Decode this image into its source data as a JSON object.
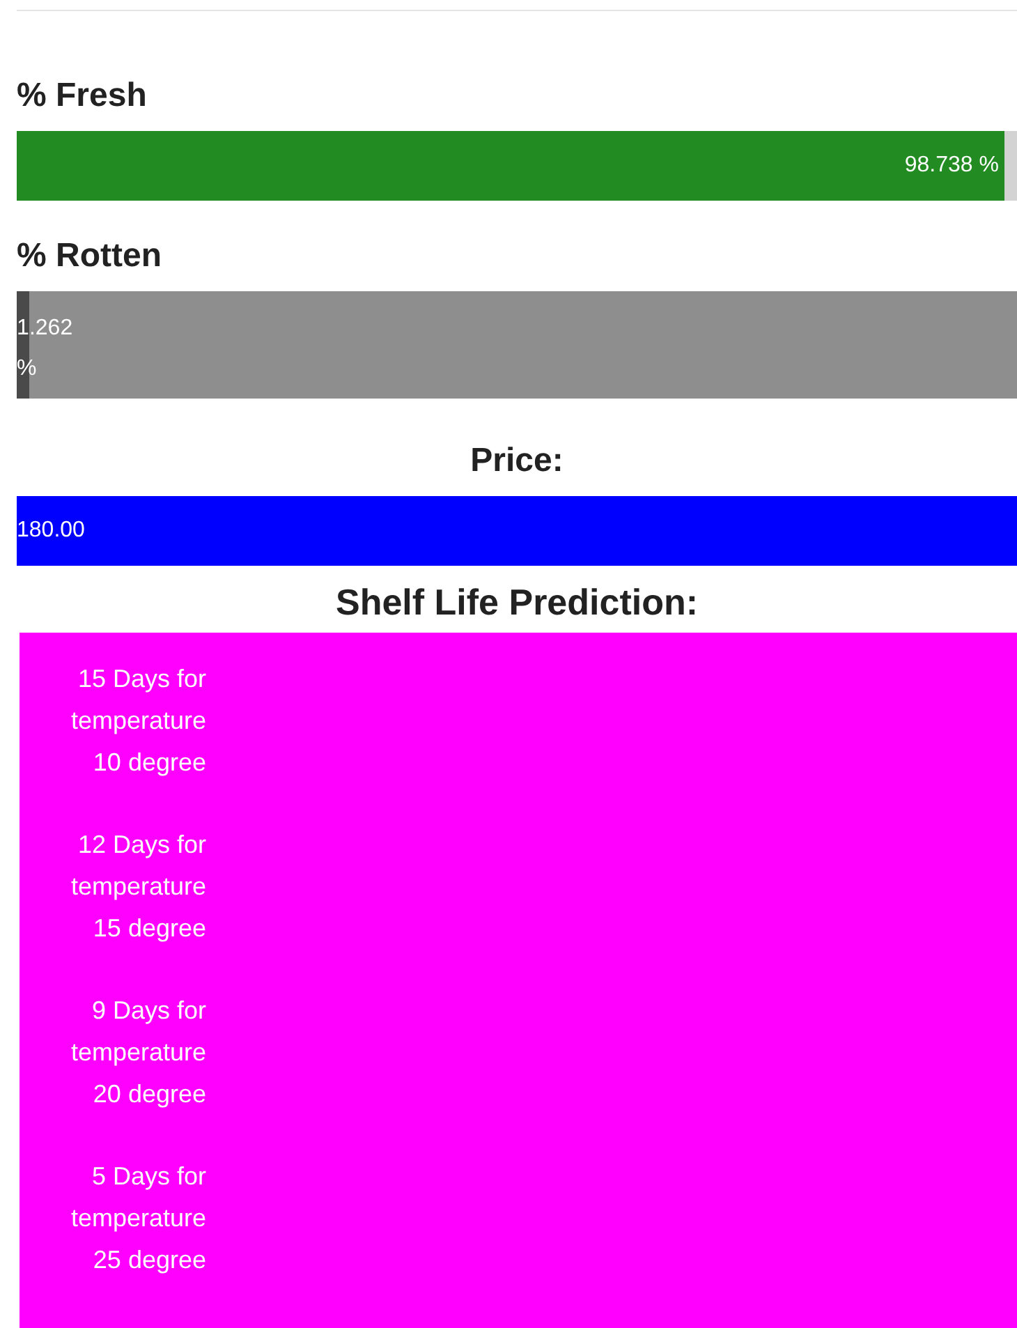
{
  "fresh": {
    "title": "% Fresh",
    "level": 0.98738,
    "reading": "98.738 %"
  },
  "rotten": {
    "title": "% Rotten",
    "level": 0.01262,
    "reading": "1.262 %"
  },
  "price": {
    "title": "Price:",
    "value": "180.00"
  },
  "shelf_life": {
    "title": "Shelf Life Prediction:",
    "items": [
      "15 Days for temperature 10 degree",
      "12 Days for temperature 15 degree",
      "9 Days for temperature 20 degree",
      "5 Days for temperature 25 degree"
    ]
  }
}
